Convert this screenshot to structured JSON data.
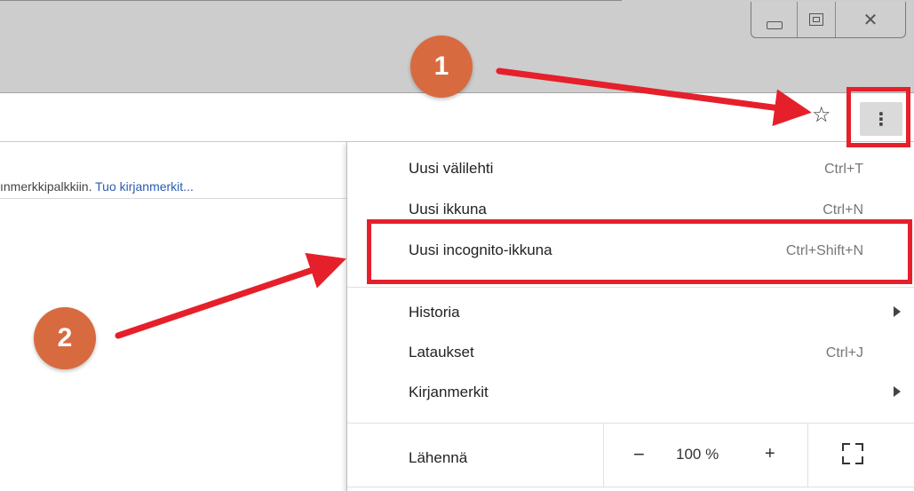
{
  "window": {
    "controls": {
      "minimize": "minimize",
      "maximize": "maximize",
      "close": "✕"
    }
  },
  "toolbar": {
    "star_icon": "star-icon",
    "menu_icon": "⋮"
  },
  "bookmarks_bar": {
    "text": "ınmerkkipalkkiin. ",
    "link": "Tuo kirjanmerkit..."
  },
  "menu": {
    "items": [
      {
        "label": "Uusi välilehti",
        "shortcut": "Ctrl+T"
      },
      {
        "label": "Uusi ikkuna",
        "shortcut": "Ctrl+N"
      },
      {
        "label": "Uusi incognito-ikkuna",
        "shortcut": "Ctrl+Shift+N"
      },
      {
        "label": "Historia",
        "shortcut": ""
      },
      {
        "label": "Lataukset",
        "shortcut": "Ctrl+J"
      },
      {
        "label": "Kirjanmerkit",
        "shortcut": ""
      }
    ],
    "zoom": {
      "label": "Lähennä",
      "minus": "−",
      "value": "100 %",
      "plus": "+"
    }
  },
  "callouts": {
    "one": "1",
    "two": "2"
  },
  "colors": {
    "highlight": "#e5202a",
    "callout": "#d86a3f"
  }
}
